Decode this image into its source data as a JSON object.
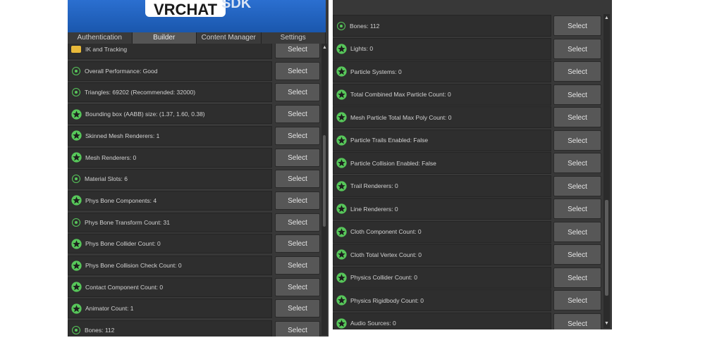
{
  "banner": {
    "logo_text": "VRCHAT",
    "sdk_text": "SDK"
  },
  "tabs": [
    {
      "label": "Authentication",
      "active": false
    },
    {
      "label": "Builder",
      "active": true
    },
    {
      "label": "Content Manager",
      "active": false
    },
    {
      "label": "Settings",
      "active": false
    }
  ],
  "select_label": "Select",
  "left_items": [
    {
      "label": "IK and Tracking",
      "icon": "warning-icon"
    },
    {
      "label": "Overall Performance: Good",
      "icon": "check-circle-icon"
    },
    {
      "label": "Triangles: 69202 (Recommended: 32000)",
      "icon": "check-circle-icon"
    },
    {
      "label": "Bounding box (AABB) size: (1.37, 1.60, 0.38)",
      "icon": "star-icon"
    },
    {
      "label": "Skinned Mesh Renderers: 1",
      "icon": "star-icon"
    },
    {
      "label": "Mesh Renderers: 0",
      "icon": "star-icon"
    },
    {
      "label": "Material Slots: 6",
      "icon": "check-circle-icon"
    },
    {
      "label": "Phys Bone Components: 4",
      "icon": "star-icon"
    },
    {
      "label": "Phys Bone Transform Count: 31",
      "icon": "check-circle-icon"
    },
    {
      "label": "Phys Bone Collider Count: 0",
      "icon": "star-icon"
    },
    {
      "label": "Phys Bone Collision Check Count: 0",
      "icon": "star-icon"
    },
    {
      "label": "Contact Component Count: 0",
      "icon": "star-icon"
    },
    {
      "label": "Animator Count: 1",
      "icon": "star-icon"
    },
    {
      "label": "Bones: 112",
      "icon": "check-circle-icon"
    }
  ],
  "right_items": [
    {
      "label": "Bones: 112",
      "icon": "check-circle-icon"
    },
    {
      "label": "Lights: 0",
      "icon": "star-icon"
    },
    {
      "label": "Particle Systems: 0",
      "icon": "star-icon"
    },
    {
      "label": "Total Combined Max Particle Count: 0",
      "icon": "star-icon"
    },
    {
      "label": "Mesh Particle Total Max Poly Count: 0",
      "icon": "star-icon"
    },
    {
      "label": "Particle Trails Enabled: False",
      "icon": "star-icon"
    },
    {
      "label": "Particle Collision Enabled: False",
      "icon": "star-icon"
    },
    {
      "label": "Trail Renderers: 0",
      "icon": "star-icon"
    },
    {
      "label": "Line Renderers: 0",
      "icon": "star-icon"
    },
    {
      "label": "Cloth Component Count: 0",
      "icon": "star-icon"
    },
    {
      "label": "Cloth Total Vertex Count: 0",
      "icon": "star-icon"
    },
    {
      "label": "Physics Collider Count: 0",
      "icon": "star-icon"
    },
    {
      "label": "Physics Rigidbody Count: 0",
      "icon": "star-icon"
    },
    {
      "label": "Audio Sources: 0",
      "icon": "star-icon"
    }
  ],
  "colors": {
    "good_green": "#57c75a",
    "warning_yellow": "#e8b93a",
    "panel_bg": "#383838"
  }
}
